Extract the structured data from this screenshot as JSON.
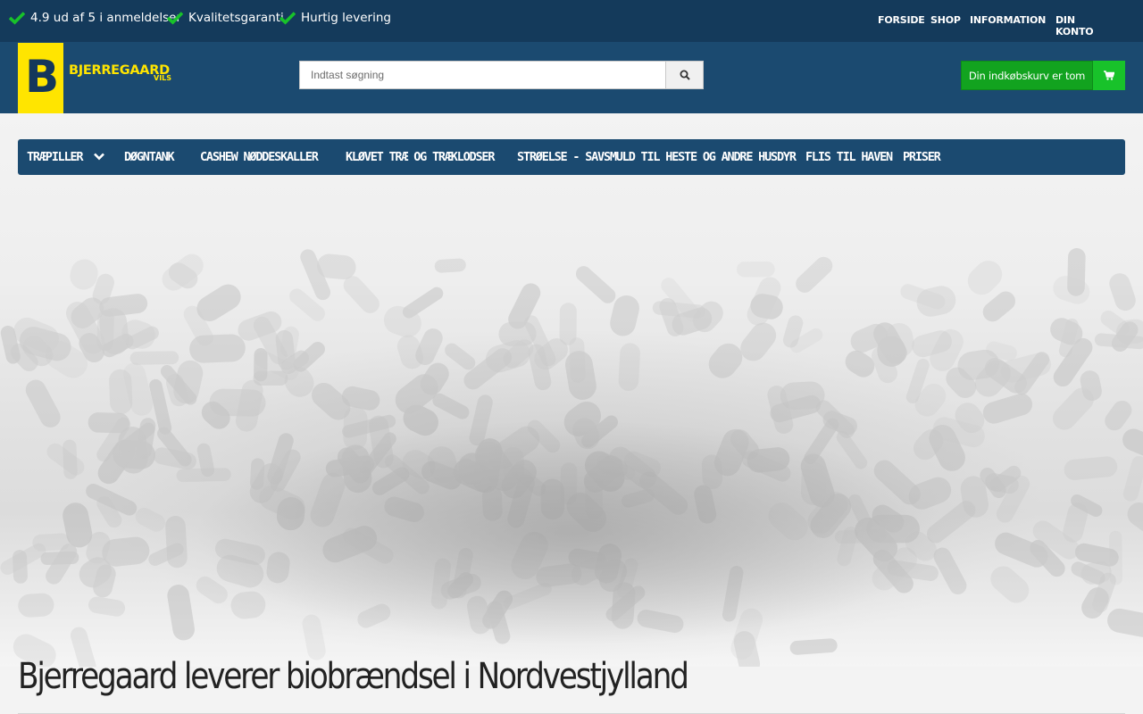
{
  "topbar": {
    "usps": [
      {
        "label": "4.9 ud af 5 i anmeldelser",
        "icon": "check-icon"
      },
      {
        "label": "Kvalitetsgaranti",
        "icon": "check-icon"
      },
      {
        "label": "Hurtig levering",
        "icon": "check-icon"
      }
    ],
    "nav": [
      "FORSIDE",
      "SHOP",
      "INFORMATION",
      "DIN KONTO"
    ]
  },
  "header": {
    "logo": {
      "letter": "B",
      "name": "BJERREGAARD",
      "sub": "VILS"
    },
    "search": {
      "placeholder": "Indtast søgning",
      "icon": "search-icon"
    },
    "cart": {
      "label": "Din indkøbskurv er tom",
      "icon": "cart-icon"
    }
  },
  "mainnav": {
    "items": [
      "TRÆPILLER",
      "DØGNTANK",
      "CASHEW NØDDESKALLER",
      "KLØVET TRÆ OG TRÆKLODSER",
      "STRØELSE - SAVSMULD TIL HESTE OG ANDRE HUSDYR",
      "FLIS TIL HAVEN",
      "PRISER"
    ]
  },
  "main": {
    "heading": "Bjerregaard leverer biobrændsel i Nordvestjylland"
  },
  "colors": {
    "topbar": "#143a5b",
    "header": "#1b4a70",
    "accent_yellow": "#ffe500",
    "cart_green": "#12a31f",
    "check_green": "#18c22a"
  }
}
